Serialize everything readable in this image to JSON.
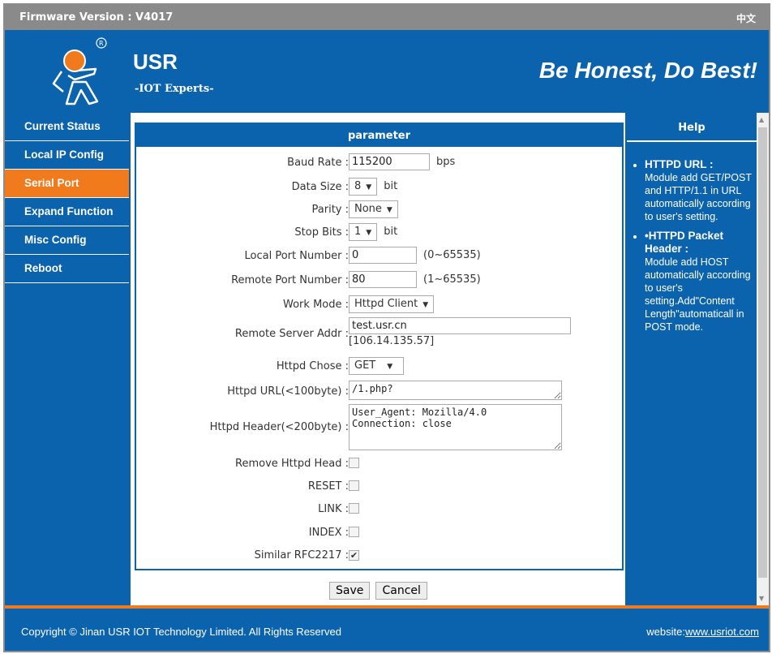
{
  "topbar": {
    "firmware": "Firmware Version : V4017",
    "lang": "中文"
  },
  "header": {
    "brand": "USR",
    "tagline": "-IOT Experts-",
    "slogan": "Be Honest, Do Best!"
  },
  "sidebar": {
    "items": [
      {
        "label": "Current Status"
      },
      {
        "label": "Local IP Config"
      },
      {
        "label": "Serial Port",
        "active": true
      },
      {
        "label": "Expand Function"
      },
      {
        "label": "Misc Config"
      },
      {
        "label": "Reboot"
      }
    ]
  },
  "colors": {
    "brand_blue": "#0b62ad",
    "accent_orange": "#f07a1c",
    "topbar_gray": "#8a8a8a"
  },
  "form": {
    "title": "parameter",
    "baud": {
      "label": "Baud Rate :",
      "value": "115200",
      "unit": "bps"
    },
    "data_size": {
      "label": "Data Size :",
      "value": "8",
      "unit": "bit"
    },
    "parity": {
      "label": "Parity :",
      "value": "None"
    },
    "stop_bits": {
      "label": "Stop Bits :",
      "value": "1",
      "unit": "bit"
    },
    "local_port": {
      "label": "Local Port Number :",
      "value": "0",
      "range": "(0~65535)"
    },
    "remote_port": {
      "label": "Remote Port Number :",
      "value": "80",
      "range": "(1~65535)"
    },
    "work_mode": {
      "label": "Work Mode :",
      "value": "Httpd Client"
    },
    "remote_server": {
      "label": "Remote Server Addr :",
      "value": "test.usr.cn",
      "resolved": "[106.14.135.57]"
    },
    "httpd_chose": {
      "label": "Httpd Chose :",
      "value": "GET"
    },
    "httpd_url": {
      "label": "Httpd URL(<100byte) :",
      "value": "/1.php?"
    },
    "httpd_header": {
      "label": "Httpd Header(<200byte) :",
      "value": "User_Agent: Mozilla/4.0\nConnection: close"
    },
    "remove_head": {
      "label": "Remove Httpd Head :",
      "checked": false
    },
    "reset": {
      "label": "RESET :",
      "checked": false
    },
    "link": {
      "label": "LINK :",
      "checked": false
    },
    "index": {
      "label": "INDEX :",
      "checked": false
    },
    "rfc2217": {
      "label": "Similar RFC2217 :",
      "checked": true
    },
    "save": "Save",
    "cancel": "Cancel"
  },
  "help": {
    "title": "Help",
    "items": [
      {
        "title": "HTTPD URL :",
        "text": "Module add GET/POST and HTTP/1.1 in URL automatically according to user's setting."
      },
      {
        "title": "•HTTPD Packet Header :",
        "text": "Module add HOST automatically according to user's setting.Add\"Content Length\"automaticall in POST mode."
      }
    ]
  },
  "footer": {
    "copyright": "Copyright © Jinan USR IOT Technology Limited. All Rights Reserved",
    "website_label": "website:",
    "website_link": "www.usriot.com"
  }
}
